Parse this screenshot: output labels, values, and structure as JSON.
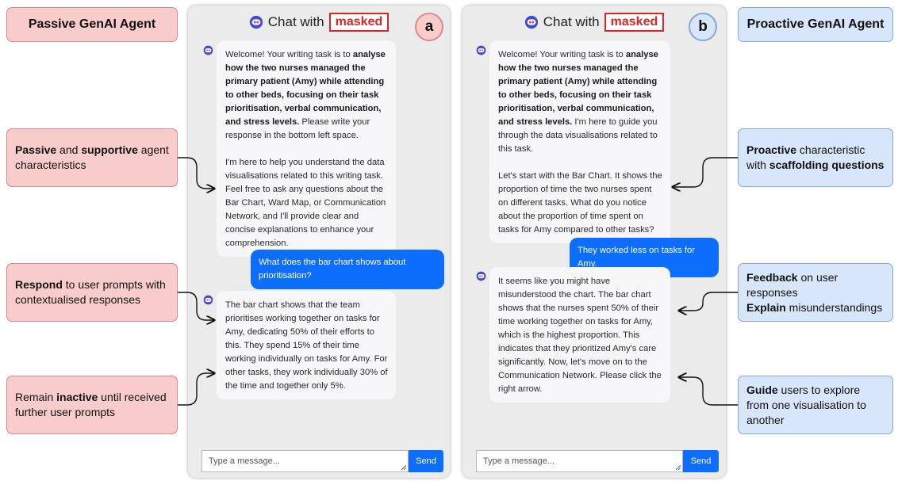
{
  "headers": {
    "passive": "Passive GenAI Agent",
    "proactive": "Proactive GenAI Agent"
  },
  "notes": {
    "passive_chars": {
      "b1": "Passive",
      "t1": " and ",
      "b2": "supportive",
      "t2": " agent characteristics"
    },
    "respond": {
      "b1": "Respond",
      "t1": " to user prompts with contextualised responses"
    },
    "inactive": {
      "t0": "Remain ",
      "b1": "inactive",
      "t1": " until received further user prompts"
    },
    "proactive_chars": {
      "b1": "Proactive",
      "t1": " characteristic with ",
      "b2": "scaffolding questions"
    },
    "feedback": {
      "b1": "Feedback",
      "t1": " on user responses",
      "b2": "Explain",
      "t2": " misunderstandings"
    },
    "guide": {
      "b1": "Guide",
      "t1": " users to explore from one visualisation to another"
    }
  },
  "chat_a": {
    "title": "Chat with",
    "masked": "masked",
    "badge": "a",
    "welcome": {
      "t1": "Welcome! Your writing task is to ",
      "b1": "analyse how the two nurses managed the primary patient (Amy) while attending to other beds, focusing on their task prioritisation, verbal communication, and stress levels.",
      "t2": " Please write your response in the bottom left space.",
      "p2": "I'm here to help you understand the data visualisations related to this writing task. Feel free to ask any questions about the Bar Chart, Ward Map, or Communication Network, and I'll provide clear and concise explanations to enhance your comprehension."
    },
    "user_msg": "What does the bar chart shows about prioritisation?",
    "reply": "The bar chart shows that the team prioritises working together on tasks for Amy, dedicating 50% of their efforts to this. They spend 15% of their time working individually on tasks for Amy. For other tasks, they work individually 30% of the time and together only 5%.",
    "input_placeholder": "Type a message...",
    "send_label": "Send"
  },
  "chat_b": {
    "title": "Chat with",
    "masked": "masked",
    "badge": "b",
    "welcome": {
      "t1": "Welcome! Your writing task is to ",
      "b1": "analyse how the two nurses managed the primary patient (Amy) while attending to other beds, focusing on their task prioritisation, verbal communication, and stress levels.",
      "t2": " I'm here to guide you through the data visualisations related to this task.",
      "p2": "Let's start with the Bar Chart. It shows the proportion of time the two nurses spent on different tasks. What do you notice about the proportion of time spent on tasks for Amy compared to other tasks?"
    },
    "user_msg": "They worked less on tasks for Amy.",
    "reply": "It seems like you might have misunderstood the chart. The bar chart shows that the nurses spent 50% of their time working together on tasks for Amy, which is the highest proportion. This indicates that they prioritized Amy's care significantly. Now, let's move on to the Communication Network. Please click the right arrow.",
    "input_placeholder": "Type a message...",
    "send_label": "Send"
  },
  "colors": {
    "passive_fill": "#f9cccc",
    "proactive_fill": "#d7e6fa",
    "send_blue": "#0d6efd",
    "masked_red": "#d9262b"
  },
  "icons": [
    "bot-logo-icon",
    "bot-avatar-icon",
    "resize-grip-icon",
    "curved-arrow-icon"
  ]
}
